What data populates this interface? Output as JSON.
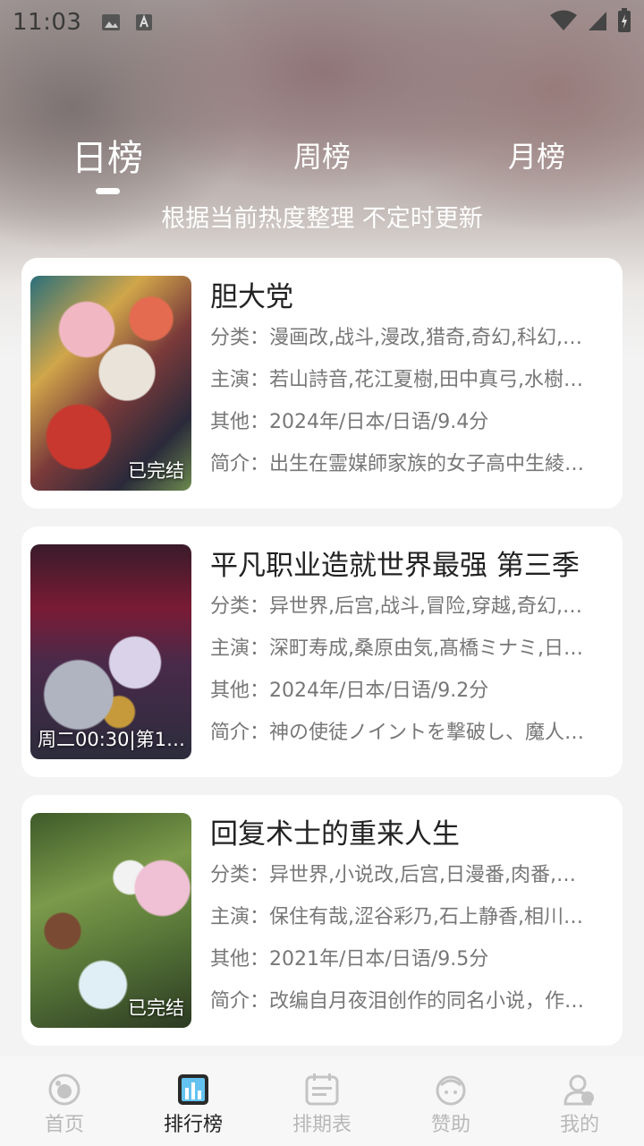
{
  "status_bar": {
    "time": "11:03"
  },
  "tabs": [
    {
      "label": "日榜",
      "active": true
    },
    {
      "label": "周榜",
      "active": false
    },
    {
      "label": "月榜",
      "active": false
    }
  ],
  "subtitle": "根据当前热度整理 不定时更新",
  "items": [
    {
      "title": "胆大党",
      "badge": "已完结",
      "genre": "分类：漫画改,战斗,漫改,猎奇,奇幻,科幻,…",
      "cast": "主演：若山詩音,花江夏樹,田中真弓,水樹…",
      "other": "其他：2024年/日本/日语/9.4分",
      "intro": "简介：出生在霊媒師家族的女子高中生綾…"
    },
    {
      "title": "平凡职业造就世界最强 第三季",
      "badge": "周二00:30|第11…",
      "genre": "分类：异世界,后宫,战斗,冒险,穿越,奇幻,…",
      "cast": "主演：深町寿成,桑原由気,髙橋ミナミ,日…",
      "other": "其他：2024年/日本/日语/9.2分",
      "intro": "简介：神の使徒ノイントを撃破し、魔人…"
    },
    {
      "title": "回复术士的重来人生",
      "badge": "已完结",
      "genre": "分类：异世界,小说改,后宫,日漫番,肉番,…",
      "cast": "主演：保住有哉,涩谷彩乃,石上静香,相川…",
      "other": "其他：2021年/日本/日语/9.5分",
      "intro": "简介：改编自月夜泪创作的同名小说，作…"
    }
  ],
  "bottom_nav": [
    {
      "label": "首页",
      "icon": "home-icon",
      "active": false
    },
    {
      "label": "排行榜",
      "icon": "ranking-icon",
      "active": true
    },
    {
      "label": "排期表",
      "icon": "calendar-icon",
      "active": false
    },
    {
      "label": "赞助",
      "icon": "sponsor-icon",
      "active": false
    },
    {
      "label": "我的",
      "icon": "profile-icon",
      "active": false
    }
  ]
}
